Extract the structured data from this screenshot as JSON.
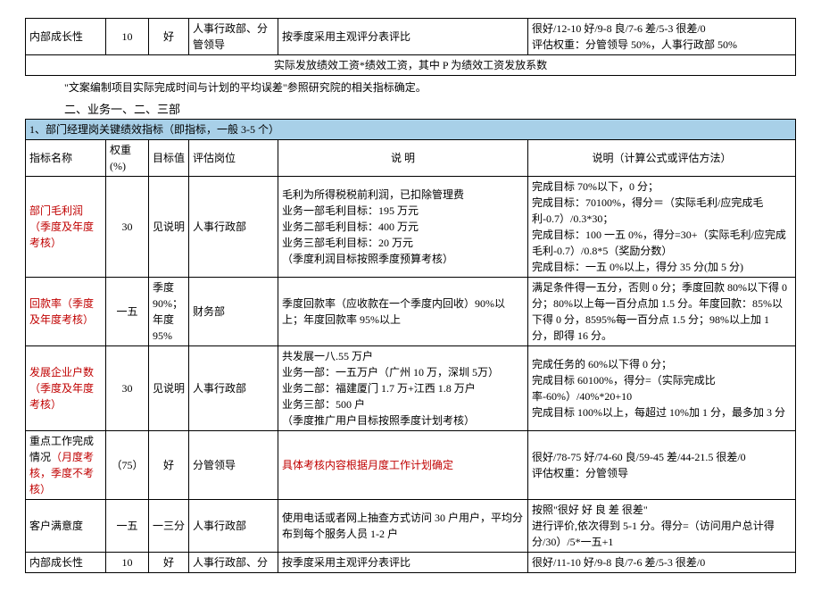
{
  "table1": {
    "r1": {
      "c0": "内部成长性",
      "c1": "10",
      "c2": "好",
      "c3": "人事行政部、分管领导",
      "c4": "按季度采用主观评分表评比",
      "c5": "很好/12-10 好/9-8 良/7-6   差/5-3 很差/0\n评估权重：分管领导 50%，人事行政部 50%"
    },
    "r2": {
      "merged": "实际发放绩效工资*绩效工资，其中 P 为绩效工资发放系数"
    }
  },
  "note1": "\"文案编制项目实际完成时间与计划的平均误差\"参照研究院的相关指标确定。",
  "section_heading": "二、业务一、二、三部",
  "table2": {
    "header_bar": "1、部门经理岗关键绩效指标（即指标，一般 3-5 个）",
    "head": {
      "c0": "指标名称",
      "c1": "权重(%)",
      "c2": "目标值",
      "c3": "评估岗位",
      "c4": "说  明",
      "c5": "说明（计算公式或评估方法）"
    },
    "r1": {
      "c0": "部门毛利润（季度及年度考核）",
      "c1": "30",
      "c2": "见说明",
      "c3": "人事行政部",
      "c4": "毛利为所得税税前利润，已扣除管理费\n业务一部毛利目标：195 万元\n业务二部毛利目标：400 万元\n业务三部毛利目标：20 万元\n（季度利润目标按照季度预算考核）",
      "c5": "完成目标 70%以下，0 分；\n完成目标：70100%，得分＝（实际毛利/应完成毛利-0.7）/0.3*30；\n完成目标：100 一五 0%，得分=30+（实际毛利/应完成毛利-0.7）/0.8*5（奖励分数）\n完成目标：一五 0%以上，得分 35 分(加 5 分)"
    },
    "r2": {
      "c0": "回款率（季度及年度考核）",
      "c1": "一五",
      "c2": "季度90%；年度 95%",
      "c3": "财务部",
      "c4": "季度回款率（应收款在一个季度内回收）90%以上；年度回款率 95%以上",
      "c5": "满足条件得一五分，否则 0 分；季度回款 80%以下得 0 分；80%以上每一百分点加 1.5 分。年度回款：85%以下得 0 分，8595%每一百分点 1.5 分；98%以上加 1 分，即得 16 分。"
    },
    "r3": {
      "c0": "发展企业户数（季度及年度考核）",
      "c1": "30",
      "c2": "见说明",
      "c3": "人事行政部",
      "c4": "共发展一八.55 万户\n业务一部：一五万户（广州 10 万，深圳 5万）\n业务二部：福建厦门 1.7 万+江西 1.8 万户\n业务三部：500 户\n（季度推广用户目标按照季度计划考核）",
      "c5": "完成任务的 60%以下得 0 分；\n完成目标 60100%，得分=（实际完成比率-60%）/40%*20+10\n完成目标 100%以上，每超过 10%加 1 分，最多加 3 分"
    },
    "r4": {
      "c0": "重点工作完成情况（月度考核，季度不考核）",
      "c1": "（75）",
      "c2": "好",
      "c3": "分管领导",
      "c4": "具体考核内容根据月度工作计划确定",
      "c5": "很好/78-75 好/74-60 良/59-45   差/44-21.5 很差/0\n评估权重：分管领导"
    },
    "r5": {
      "c0": "客户满意度",
      "c1": "一五",
      "c2": "一三分",
      "c3": "人事行政部",
      "c4": "使用电话或者网上抽查方式访问 30 户用户，平均分布到每个服务人员 1-2 户",
      "c5": "按照\"很好 好 良 差 很差\"\n进行评价,依次得到 5-1 分。得分=（访问用户总计得分/30）/5*一五+1"
    },
    "r6": {
      "c0": "内部成长性",
      "c1": "10",
      "c2": "好",
      "c3": "人事行政部、分",
      "c4": "按季度采用主观评分表评比",
      "c5": "很好/11-10 好/9-8   良/7-6   差/5-3 很差/0"
    }
  }
}
